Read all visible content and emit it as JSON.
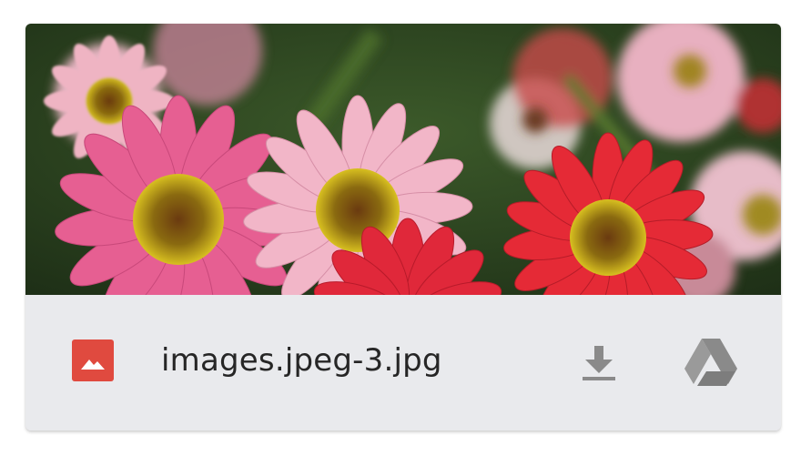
{
  "attachment": {
    "file_name": "images.jpeg-3.jpg",
    "file_type_icon": "image-file-icon",
    "actions": {
      "download_icon": "download-icon",
      "drive_icon": "google-drive-icon"
    }
  },
  "colors": {
    "file_icon_bg": "#e04a3f",
    "action_icon": "#8a8a8a",
    "bar_bg": "#e9eaed",
    "text": "#262626"
  }
}
